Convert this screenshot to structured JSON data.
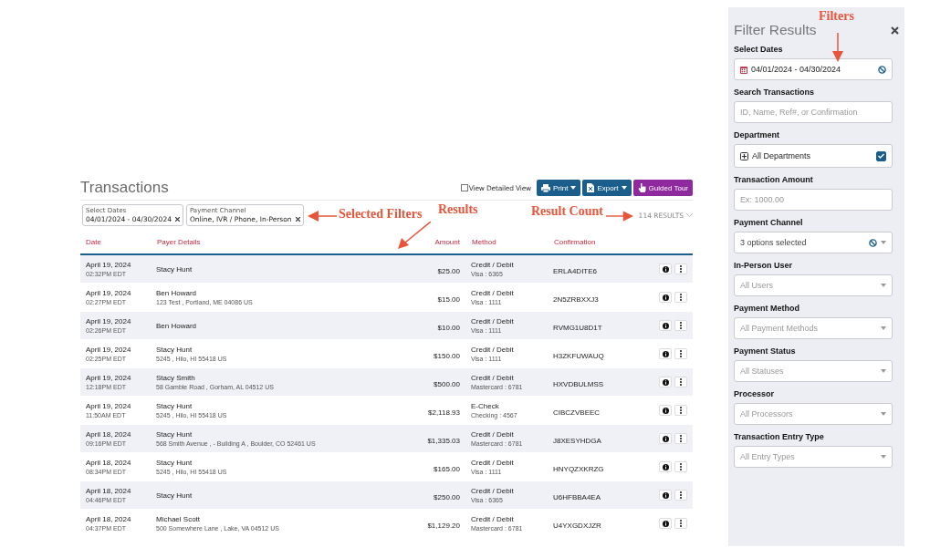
{
  "page": {
    "title": "Transactions"
  },
  "toolbar": {
    "detailed_view": {
      "label": "View Detailed View",
      "checked": false
    },
    "buttons": [
      {
        "kind": "print",
        "label": "Print",
        "dropdown": true
      },
      {
        "kind": "export",
        "label": "Export",
        "dropdown": true
      },
      {
        "kind": "tour",
        "label": "Guided Tour",
        "dropdown": false
      }
    ]
  },
  "selected_filters": [
    {
      "label": "Select Dates",
      "value": "04/01/2024 - 04/30/2024"
    },
    {
      "label": "Payment Channel",
      "value": "Online, IVR / Phone, In-Person"
    }
  ],
  "result_count": "114 RESULTS",
  "table": {
    "columns": [
      "Date",
      "Payer Details",
      "Amount",
      "Method",
      "Confirmation"
    ],
    "rows": [
      {
        "date": "April 19, 2024",
        "time": "02:32PM EDT",
        "payer": "Stacy Hunt",
        "address": "",
        "amount": "$25.00",
        "method": "Credit / Debit",
        "account": "Visa : 6365",
        "confirmation": "ERLA4DITE6"
      },
      {
        "date": "April 19, 2024",
        "time": "02:27PM EDT",
        "payer": "Ben Howard",
        "address": "123 Test , Portland, ME 04086 US",
        "amount": "$15.00",
        "method": "Credit / Debit",
        "account": "Visa : 1111",
        "confirmation": "2N5ZRBXXJ3"
      },
      {
        "date": "April 19, 2024",
        "time": "02:26PM EDT",
        "payer": "Ben Howard",
        "address": "",
        "amount": "$10.00",
        "method": "Credit / Debit",
        "account": "Visa : 1111",
        "confirmation": "RVMG1U8D1T"
      },
      {
        "date": "April 19, 2024",
        "time": "02:25PM EDT",
        "payer": "Stacy Hunt",
        "address": "5245 , Hilo, HI 55418 US",
        "amount": "$150.00",
        "method": "Credit / Debit",
        "account": "Visa : 1111",
        "confirmation": "H3ZKFUWAUQ"
      },
      {
        "date": "April 19, 2024",
        "time": "12:18PM EDT",
        "payer": "Stacy Smith",
        "address": "58 Gamble Road , Gorham, AL 04512 US",
        "amount": "$500.00",
        "method": "Credit / Debit",
        "account": "Mastercard : 6781",
        "confirmation": "HXVDBULMSS"
      },
      {
        "date": "April 19, 2024",
        "time": "11:50AM EDT",
        "payer": "Stacy Hunt",
        "address": "5245 , Hilo, HI 55418 US",
        "amount": "$2,118.93",
        "method": "E-Check",
        "account": "Checking : 4567",
        "confirmation": "CIBCZVBEEC"
      },
      {
        "date": "April 18, 2024",
        "time": "09:16PM EDT",
        "payer": "Stacy Hunt",
        "address": "568 Smith Avenue , - Building A , Boulder, CO 52461 US",
        "amount": "$1,335.03",
        "method": "Credit / Debit",
        "account": "Mastercard : 6781",
        "confirmation": "J8XESYHDGA"
      },
      {
        "date": "April 18, 2024",
        "time": "08:34PM EDT",
        "payer": "Stacy Hunt",
        "address": "5245 , Hilo, HI 55418 US",
        "amount": "$165.00",
        "method": "Credit / Debit",
        "account": "Visa : 1111",
        "confirmation": "HNYQZXKRZG"
      },
      {
        "date": "April 18, 2024",
        "time": "04:46PM EDT",
        "payer": "Stacy Hunt",
        "address": "",
        "amount": "$250.00",
        "method": "Credit / Debit",
        "account": "Visa : 6365",
        "confirmation": "U6HFBBA4EA"
      },
      {
        "date": "April 18, 2024",
        "time": "04:37PM EDT",
        "payer": "Michael Scott",
        "address": "500 Somewhere Lane , Lake, VA 04512 US",
        "amount": "$1,129.20",
        "method": "Credit / Debit",
        "account": "Mastercard : 6781",
        "confirmation": "U4YXGDXJZR"
      }
    ]
  },
  "filter_panel": {
    "title": "Filter Results",
    "fields": [
      {
        "kind": "date",
        "label": "Select Dates",
        "value": "04/01/2024 - 04/30/2024"
      },
      {
        "kind": "text",
        "label": "Search Transactions",
        "placeholder": "ID, Name, Ref#, or Confirmation"
      },
      {
        "kind": "tree",
        "label": "Department",
        "value": "All Departments",
        "checked": true
      },
      {
        "kind": "text",
        "label": "Transaction Amount",
        "placeholder": "Ex: 1000.00"
      },
      {
        "kind": "multi",
        "label": "Payment Channel",
        "value": "3 options selected"
      },
      {
        "kind": "select",
        "label": "In-Person User",
        "placeholder": "All Users"
      },
      {
        "kind": "select",
        "label": "Payment Method",
        "placeholder": "All Payment Methods"
      },
      {
        "kind": "select",
        "label": "Payment Status",
        "placeholder": "All Statuses"
      },
      {
        "kind": "select",
        "label": "Processor",
        "placeholder": "All Processors"
      },
      {
        "kind": "select",
        "label": "Transaction Entry Type",
        "placeholder": "All Entry Types"
      }
    ]
  },
  "annotations": [
    {
      "kind": "filters",
      "label": "Filters"
    },
    {
      "kind": "selected",
      "label": "Selected Filters"
    },
    {
      "kind": "results",
      "label": "Results"
    },
    {
      "kind": "count",
      "label": "Result Count"
    }
  ]
}
